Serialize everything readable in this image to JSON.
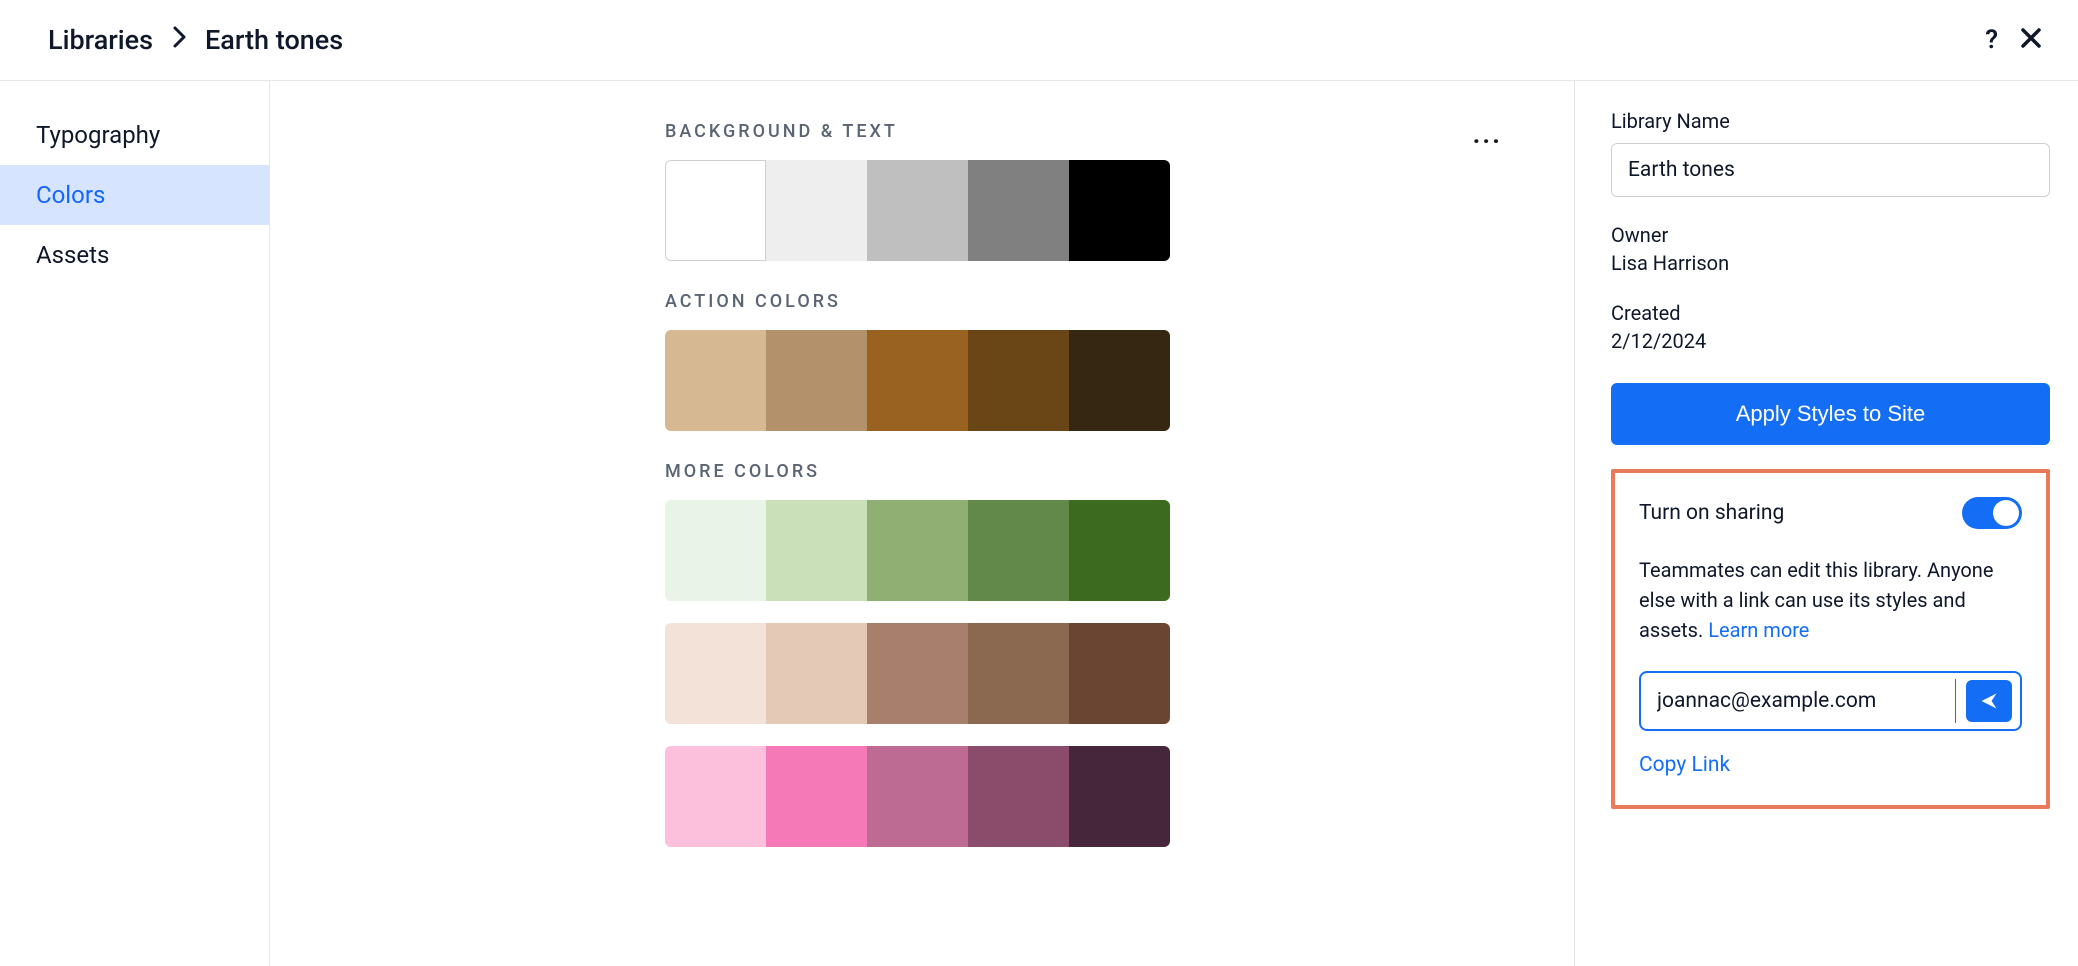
{
  "breadcrumb": {
    "root": "Libraries",
    "current": "Earth tones"
  },
  "sidebar": {
    "items": [
      {
        "label": "Typography",
        "active": false
      },
      {
        "label": "Colors",
        "active": true
      },
      {
        "label": "Assets",
        "active": false
      }
    ]
  },
  "sections": {
    "background_text": {
      "label": "BACKGROUND & TEXT",
      "colors": [
        "#ffffff",
        "#eeeeee",
        "#bfbfbf",
        "#808080",
        "#000000"
      ]
    },
    "action_colors": {
      "label": "ACTION COLORS",
      "colors": [
        "#d6b893",
        "#b3926b",
        "#9a6220",
        "#6a4516",
        "#352711"
      ]
    },
    "more_colors": {
      "label": "MORE COLORS",
      "rows": [
        [
          "#eaf3e7",
          "#c9e0b8",
          "#8fb072",
          "#62884a",
          "#3c6b20"
        ],
        [
          "#f3e2d8",
          "#e4c9b7",
          "#a87f6c",
          "#8b6850",
          "#6a4632"
        ],
        [
          "#fcc0dc",
          "#f579b6",
          "#bd6b92",
          "#8a4c6a",
          "#46263a"
        ]
      ]
    }
  },
  "panel": {
    "library_name_label": "Library Name",
    "library_name_value": "Earth tones",
    "owner_label": "Owner",
    "owner_value": "Lisa Harrison",
    "created_label": "Created",
    "created_value": "2/12/2024",
    "apply_button": "Apply Styles to Site"
  },
  "sharing": {
    "title": "Turn on sharing",
    "enabled": true,
    "description_prefix": "Teammates can edit this library. Anyone else with a link can use its styles and assets. ",
    "learn_more": "Learn more",
    "email_value": "joannac@example.com",
    "copy_link": "Copy Link"
  }
}
